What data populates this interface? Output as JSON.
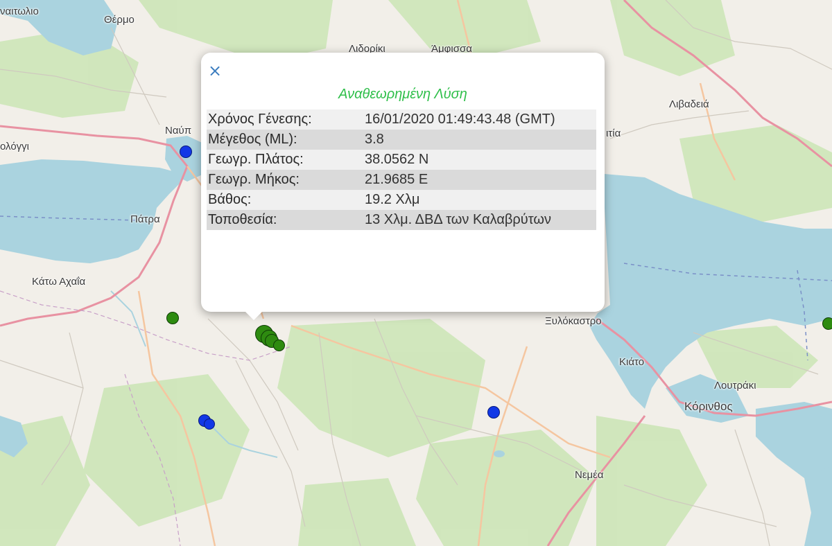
{
  "map": {
    "places": [
      {
        "name": "Θέρμο",
        "key": "thermo"
      },
      {
        "name": "ναιτωλιο",
        "key": "naitolio"
      },
      {
        "name": "Λιδορίκι",
        "key": "lidoriki"
      },
      {
        "name": "Άμφισσα",
        "key": "amfissa"
      },
      {
        "name": "Λιβαδειά",
        "key": "livadeia"
      },
      {
        "name": "Ναύπ",
        "key": "nafp"
      },
      {
        "name": "ολόγγι",
        "key": "mesologgi"
      },
      {
        "name": "ιτία",
        "key": "itia"
      },
      {
        "name": "Πάτρα",
        "key": "patra"
      },
      {
        "name": "Κάτω Αχαΐα",
        "key": "kato_achaia"
      },
      {
        "name": "Ξυλόκαστρο",
        "key": "xylokastro"
      },
      {
        "name": "Κιάτο",
        "key": "kiato"
      },
      {
        "name": "Λουτράκι",
        "key": "loutraki"
      },
      {
        "name": "Κόρινθος",
        "key": "korinthos"
      },
      {
        "name": "Νεμέα",
        "key": "nemea"
      }
    ],
    "colors": {
      "water": "#aad3df",
      "land": "#f2efe9",
      "event_recent": "#2e8b10",
      "event_older": "#1238e6",
      "popup_title": "#2fbf4a"
    }
  },
  "popup": {
    "close_icon": "×",
    "title": "Αναθεωρημένη Λύση",
    "rows": [
      {
        "label": "Χρόνος Γένεσης:",
        "value": "16/01/2020 01:49:43.48 (GMT)"
      },
      {
        "label": "Μέγεθος (ML):",
        "value": "3.8"
      },
      {
        "label": "Γεωγρ. Πλάτος:",
        "value": "38.0562 N"
      },
      {
        "label": "Γεωγρ. Μήκος:",
        "value": "21.9685 E"
      },
      {
        "label": "Βάθος:",
        "value": "19.2 Χλμ"
      },
      {
        "label": "Τοποθεσία:",
        "value": "13 Χλμ. ΔΒΔ των Καλαβρύτων"
      }
    ]
  }
}
